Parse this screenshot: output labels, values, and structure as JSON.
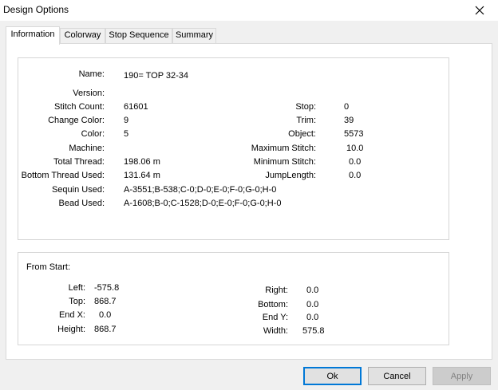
{
  "window": {
    "title": "Design Options"
  },
  "tabs": [
    {
      "label": "Information",
      "active": true
    },
    {
      "label": "Colorway",
      "active": false
    },
    {
      "label": "Stop Sequence",
      "active": false
    },
    {
      "label": "Summary",
      "active": false
    }
  ],
  "info": {
    "name": {
      "label": "Name:",
      "value": "190= TOP 32-34"
    },
    "version": {
      "label": "Version:",
      "value": ""
    },
    "stitch_count": {
      "label": "Stitch Count:",
      "value": "61601"
    },
    "change_color": {
      "label": "Change Color:",
      "value": "9"
    },
    "color": {
      "label": "Color:",
      "value": "5"
    },
    "machine": {
      "label": "Machine:",
      "value": ""
    },
    "total_thread": {
      "label": "Total Thread:",
      "value": "198.06 m"
    },
    "bottom_thread_used": {
      "label": "Bottom Thread Used:",
      "value": "131.64 m"
    },
    "sequin_used": {
      "label": "Sequin Used:",
      "value": "A-3551;B-538;C-0;D-0;E-0;F-0;G-0;H-0"
    },
    "bead_used": {
      "label": "Bead Used:",
      "value": "A-1608;B-0;C-1528;D-0;E-0;F-0;G-0;H-0"
    },
    "stop": {
      "label": "Stop:",
      "value": "0"
    },
    "trim": {
      "label": "Trim:",
      "value": "39"
    },
    "object": {
      "label": "Object:",
      "value": "5573"
    },
    "maximum_stitch": {
      "label": "Maximum Stitch:",
      "value": "10.0"
    },
    "minimum_stitch": {
      "label": "Minimum Stitch:",
      "value": "0.0"
    },
    "jump_length": {
      "label": "JumpLength:",
      "value": "0.0"
    }
  },
  "from_start": {
    "heading": "From Start:",
    "left": {
      "label": "Left:",
      "value": "-575.8"
    },
    "top": {
      "label": "Top:",
      "value": "868.7"
    },
    "end_x": {
      "label": "End X:",
      "value": "0.0"
    },
    "height": {
      "label": "Height:",
      "value": "868.7"
    },
    "right": {
      "label": "Right:",
      "value": "0.0"
    },
    "bottom": {
      "label": "Bottom:",
      "value": "0.0"
    },
    "end_y": {
      "label": "End Y:",
      "value": "0.0"
    },
    "width": {
      "label": "Width:",
      "value": "575.8"
    }
  },
  "buttons": {
    "ok": "Ok",
    "cancel": "Cancel",
    "apply": "Apply"
  },
  "colors": {
    "accent": "#0078d7",
    "disabled_text": "#838383"
  }
}
